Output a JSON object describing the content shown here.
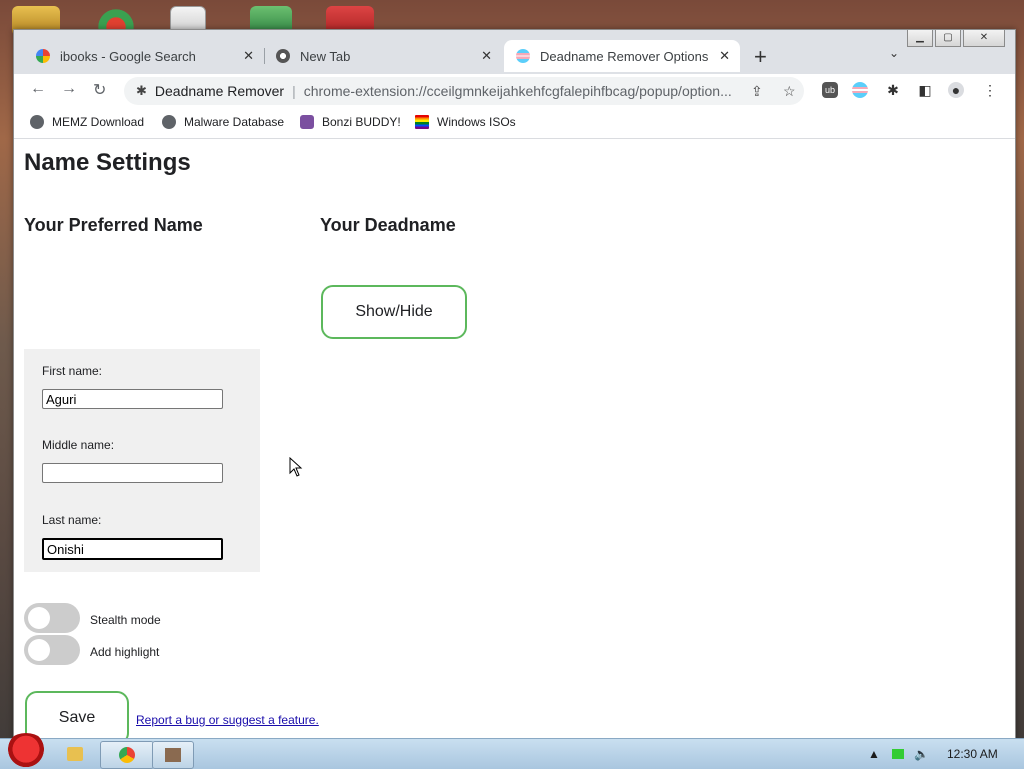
{
  "browser": {
    "tabs": [
      {
        "title": "ibooks - Google Search",
        "favicon": "google-g-icon",
        "active": false
      },
      {
        "title": "New Tab",
        "favicon": "chrome-icon",
        "active": false
      },
      {
        "title": "Deadname Remover Options",
        "favicon": "trans-flag-icon",
        "active": true
      }
    ],
    "address": {
      "extension_name": "Deadname Remover",
      "url": "chrome-extension://cceilgmnkeijahkehfcgfalepihfbcag/popup/option..."
    },
    "bookmarks": [
      {
        "label": "MEMZ Download"
      },
      {
        "label": "Malware Database"
      },
      {
        "label": "Bonzi BUDDY!"
      },
      {
        "label": "Windows ISOs"
      }
    ]
  },
  "page": {
    "title": "Name Settings",
    "preferred_heading": "Your Preferred Name",
    "deadname_heading": "Your Deadname",
    "show_hide_label": "Show/Hide",
    "fields": {
      "first": {
        "label": "First name:",
        "value": "Aguri"
      },
      "middle": {
        "label": "Middle name:",
        "value": ""
      },
      "last": {
        "label": "Last name:",
        "value": "Onishi"
      }
    },
    "toggles": {
      "stealth": {
        "label": "Stealth mode",
        "on": false
      },
      "highlight": {
        "label": "Add highlight",
        "on": false
      }
    },
    "save_label": "Save",
    "report_link": "Report a bug or suggest a feature."
  },
  "taskbar": {
    "clock": "12:30 AM"
  },
  "colors": {
    "accent_green": "#5cb85c",
    "link": "#1a0dab"
  }
}
